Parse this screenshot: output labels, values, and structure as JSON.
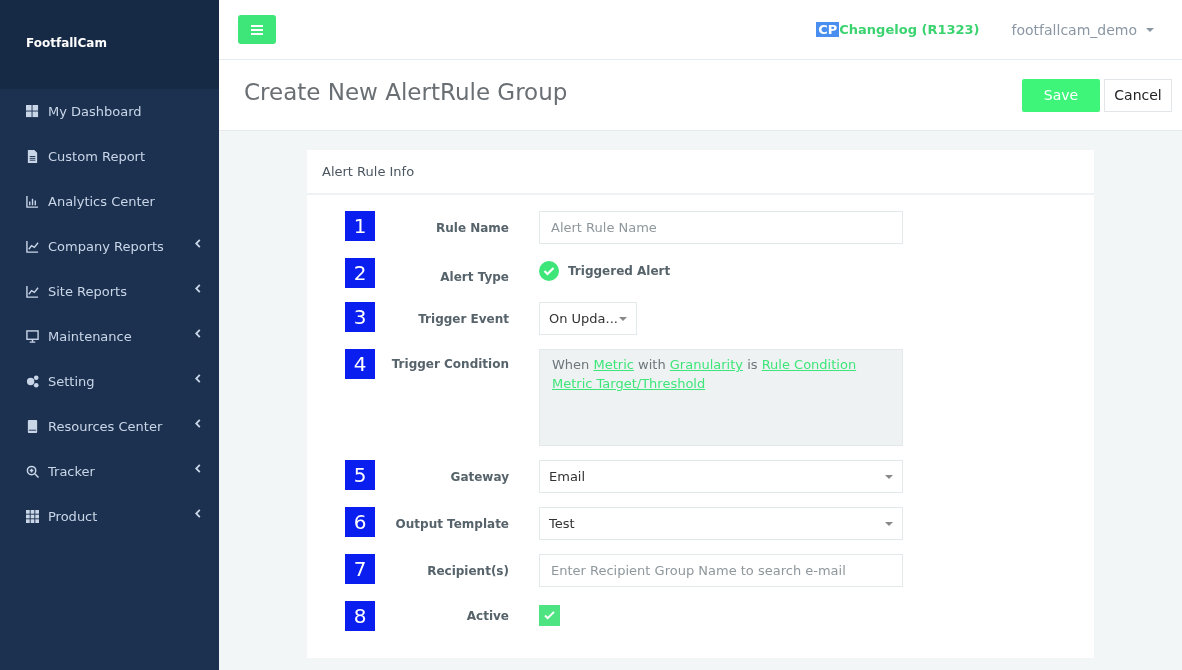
{
  "brand": "FootfallCam",
  "sidebar": {
    "items": [
      {
        "label": "My Dashboard",
        "expandable": false
      },
      {
        "label": "Custom Report",
        "expandable": false
      },
      {
        "label": "Analytics Center",
        "expandable": false
      },
      {
        "label": "Company Reports",
        "expandable": true
      },
      {
        "label": "Site Reports",
        "expandable": true
      },
      {
        "label": "Maintenance",
        "expandable": true
      },
      {
        "label": "Setting",
        "expandable": true
      },
      {
        "label": "Resources Center",
        "expandable": true
      },
      {
        "label": "Tracker",
        "expandable": true
      },
      {
        "label": "Product",
        "expandable": true
      }
    ]
  },
  "topbar": {
    "changelog_badge": "CP",
    "changelog": "Changelog (R1323)",
    "user": "footfallcam_demo"
  },
  "page": {
    "title": "Create New AlertRule Group",
    "buttons": {
      "save": "Save",
      "cancel": "Cancel"
    }
  },
  "card": {
    "title": "Alert Rule Info",
    "rows": [
      {
        "number": "1",
        "label": "Rule Name",
        "kind": "text",
        "placeholder": "Alert Rule Name"
      },
      {
        "number": "2",
        "label": "Alert Type",
        "kind": "radio",
        "option": "Triggered Alert",
        "checked": true
      },
      {
        "number": "3",
        "label": "Trigger Event",
        "kind": "select-small",
        "value": "On Upda..."
      },
      {
        "number": "4",
        "label": "Trigger Condition",
        "kind": "condition",
        "parts": [
          {
            "text": "When",
            "link": false
          },
          {
            "text": "Metric",
            "link": true
          },
          {
            "text": "with",
            "link": false
          },
          {
            "text": "Granularity",
            "link": true
          },
          {
            "text": "is",
            "link": false
          },
          {
            "text": "Rule Condition",
            "link": true
          },
          {
            "text": "Metric Target/Threshold",
            "link": true
          }
        ]
      },
      {
        "number": "5",
        "label": "Gateway",
        "kind": "select",
        "value": "Email"
      },
      {
        "number": "6",
        "label": "Output Template",
        "kind": "select",
        "value": "Test"
      },
      {
        "number": "7",
        "label": "Recipient(s)",
        "kind": "text",
        "placeholder": "Enter Recipient Group Name to search e-mail"
      },
      {
        "number": "8",
        "label": "Active",
        "kind": "checkbox",
        "checked": true
      }
    ]
  }
}
